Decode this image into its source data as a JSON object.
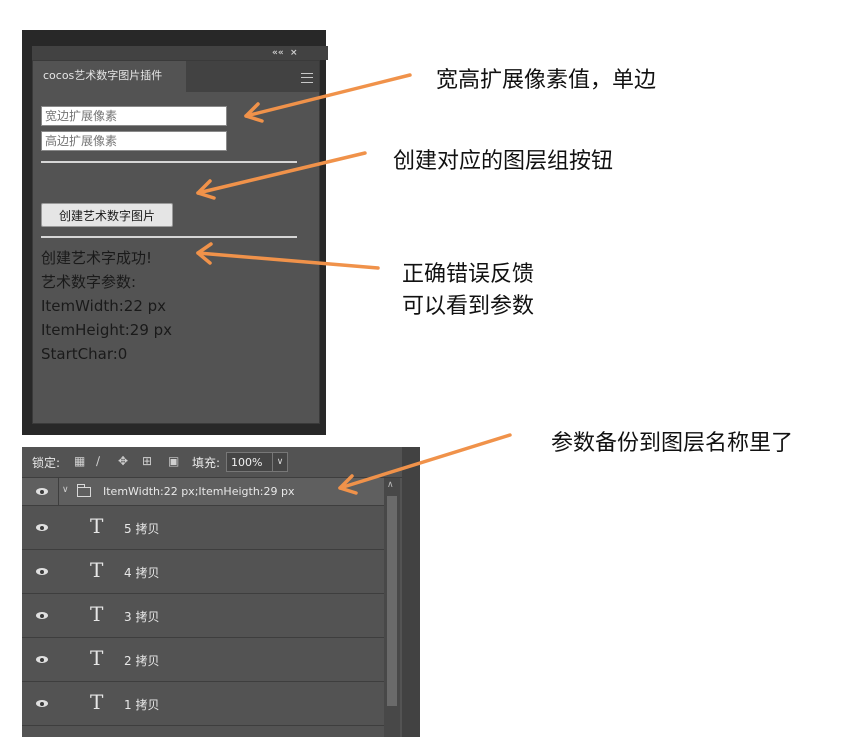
{
  "plugin_panel": {
    "collapse_glyph": "««",
    "close_glyph": "×",
    "tab_title": "cocos艺术数字图片插件",
    "menu_icon": "hamburger-icon",
    "width_expand_placeholder": "宽边扩展像素",
    "height_expand_placeholder": "高边扩展像素",
    "create_button_label": "创建艺术数字图片",
    "feedback_lines": [
      "创建艺术字成功!",
      "艺术数字参数:",
      "ItemWidth:22 px",
      "ItemHeight:29 px",
      "StartChar:0"
    ]
  },
  "layers_panel": {
    "lock_label": "锁定:",
    "lock_icons": [
      "lock-transparent-pixels-icon",
      "lock-image-pixels-icon",
      "lock-position-icon",
      "lock-artboard-icon",
      "lock-all-icon"
    ],
    "fill_label": "填充:",
    "fill_value": "100%",
    "group_name": "ItemWidth:22 px;ItemHeigth:29 px",
    "layers": [
      {
        "name": "5 拷贝"
      },
      {
        "name": "4 拷贝"
      },
      {
        "name": "3 拷贝"
      },
      {
        "name": "2 拷贝"
      },
      {
        "name": "1 拷贝"
      }
    ],
    "type_glyph": "T"
  },
  "annotations": {
    "note_expand": "宽高扩展像素值，单边",
    "note_button": "创建对应的图层组按钮",
    "note_feedback_1": "正确错误反馈",
    "note_feedback_2": "可以看到参数",
    "note_layers": "参数备份到图层名称里了",
    "arrow_color": "#F0924A"
  }
}
